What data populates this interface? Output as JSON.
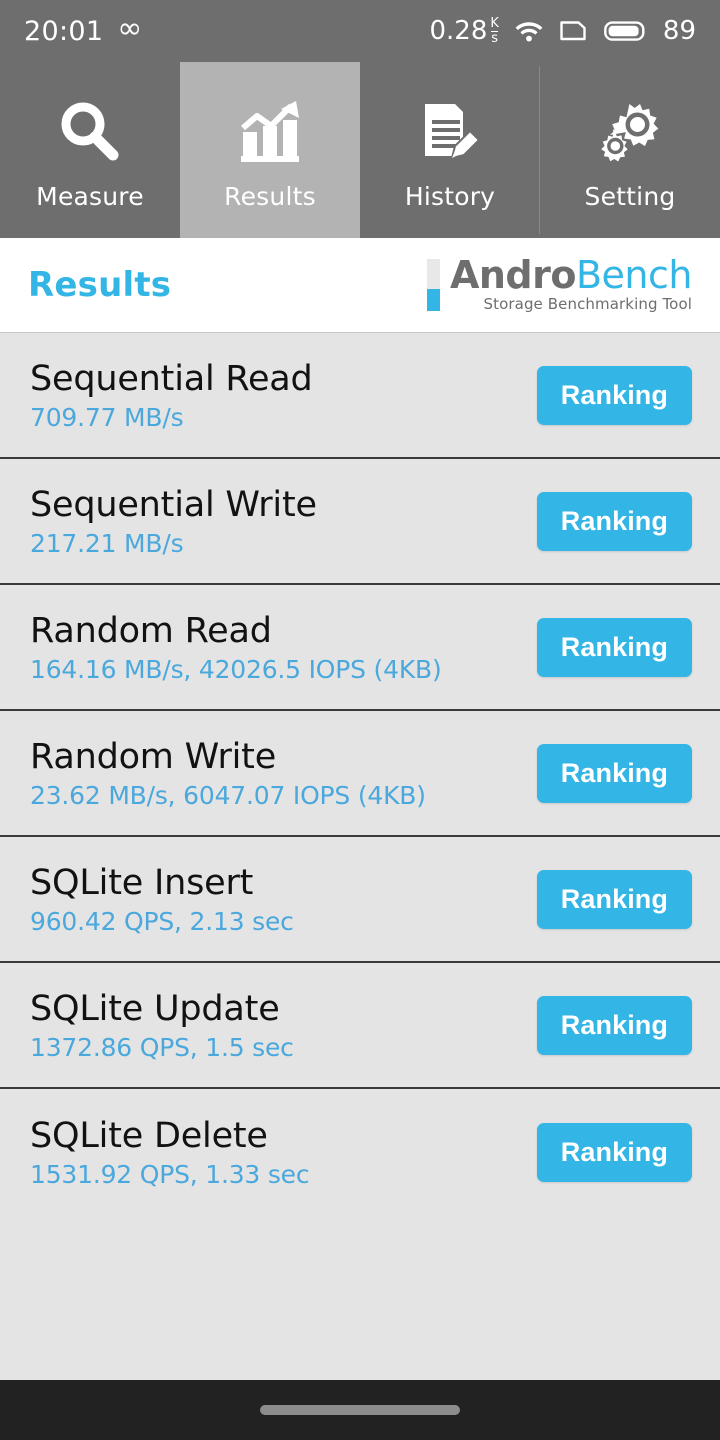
{
  "statusbar": {
    "time": "20:01",
    "infinity_icon": "infinity-icon",
    "network_speed": "0.28",
    "network_unit_num": "K",
    "network_unit_den": "s",
    "wifi_icon": "wifi-icon",
    "sim_icon": "sim-card-icon",
    "battery_icon": "battery-icon",
    "battery_level": "89"
  },
  "tabs": [
    {
      "label": "Measure",
      "icon": "magnifier-icon",
      "active": false
    },
    {
      "label": "Results",
      "icon": "bar-chart-icon",
      "active": true
    },
    {
      "label": "History",
      "icon": "document-pencil-icon",
      "active": false
    },
    {
      "label": "Setting",
      "icon": "gears-icon",
      "active": false
    }
  ],
  "header": {
    "page_title": "Results",
    "logo_name_part1": "Andro",
    "logo_name_part2": "Bench",
    "logo_tagline": "Storage Benchmarking Tool"
  },
  "results": [
    {
      "title": "Sequential Read",
      "value": "709.77 MB/s",
      "button": "Ranking"
    },
    {
      "title": "Sequential Write",
      "value": "217.21 MB/s",
      "button": "Ranking"
    },
    {
      "title": "Random Read",
      "value": "164.16 MB/s, 42026.5 IOPS (4KB)",
      "button": "Ranking"
    },
    {
      "title": "Random Write",
      "value": "23.62 MB/s, 6047.07 IOPS (4KB)",
      "button": "Ranking"
    },
    {
      "title": "SQLite Insert",
      "value": "960.42 QPS, 2.13 sec",
      "button": "Ranking"
    },
    {
      "title": "SQLite Update",
      "value": "1372.86 QPS, 1.5 sec",
      "button": "Ranking"
    },
    {
      "title": "SQLite Delete",
      "value": "1531.92 QPS, 1.33 sec",
      "button": "Ranking"
    }
  ],
  "navbar": {
    "home_pill": "home-indicator"
  },
  "colors": {
    "accent": "#33b5e5",
    "value_text": "#4aa8dd",
    "statusbar_bg": "#6e6e6e",
    "tab_active_bg": "#b3b3b3",
    "list_bg": "#e4e4e4",
    "row_divider": "#3a3a3a",
    "navbar_bg": "#222222"
  }
}
